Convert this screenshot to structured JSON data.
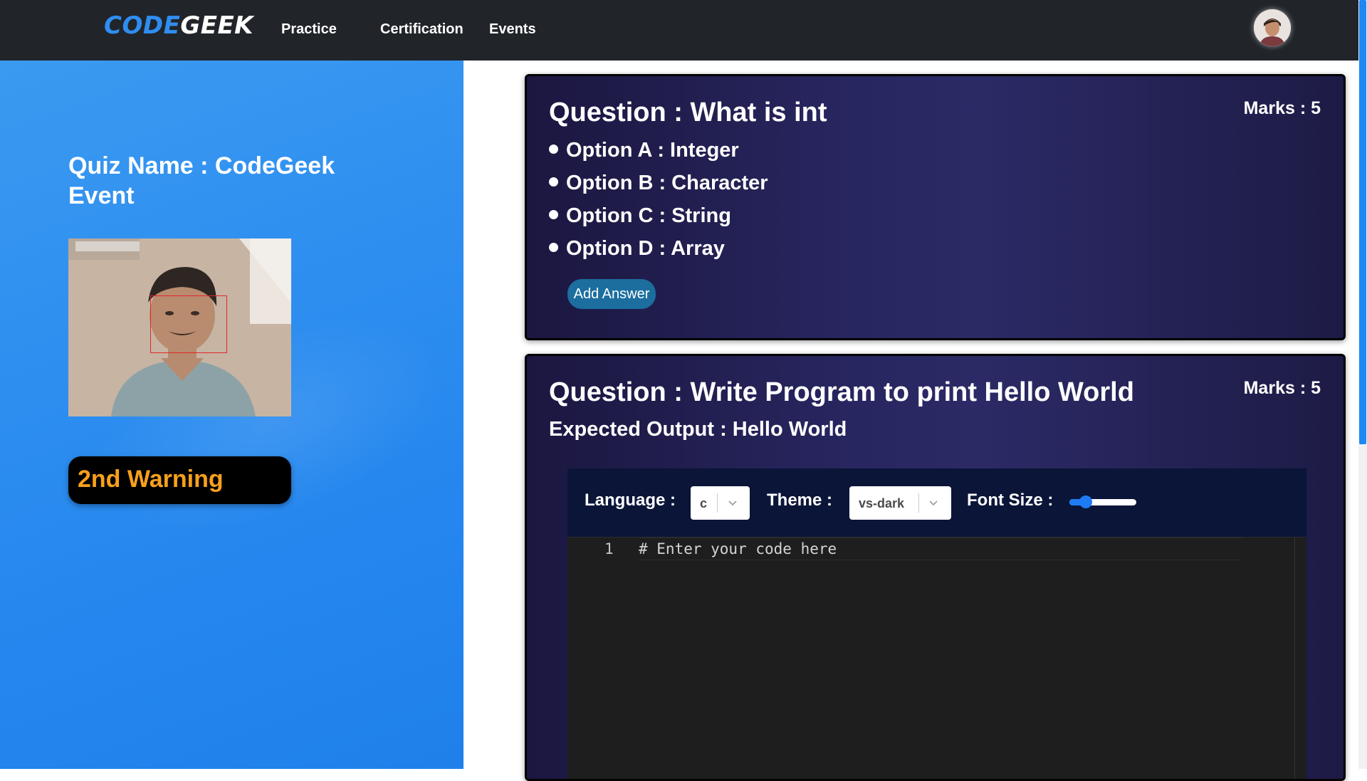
{
  "navbar": {
    "brand_part1": "CODE",
    "brand_part2": "GEEK",
    "links": [
      "Practice",
      "Certification",
      "Events"
    ],
    "avatar_icon": "user-avatar-icon"
  },
  "sidebar": {
    "quiz_name": "Quiz Name : CodeGeek Event",
    "warning": "2nd Warning",
    "warning_color": "#f7a01b"
  },
  "questions": [
    {
      "title": "Question : What is int",
      "marks": "Marks : 5",
      "options": [
        "Option A : Integer",
        "Option B : Character",
        "Option C : String",
        "Option D : Array"
      ],
      "button": "Add Answer"
    },
    {
      "title": "Question : Write Program to print Hello World",
      "marks": "Marks : 5",
      "expected_output": "Expected Output : Hello World",
      "editor": {
        "language_label": "Language :",
        "language_value": "c",
        "theme_label": "Theme :",
        "theme_value": "vs-dark",
        "font_size_label": "Font Size :",
        "font_size_slider_fraction": 0.18,
        "line_number": "1",
        "code": "# Enter your code here"
      }
    }
  ],
  "colors": {
    "navbar_bg": "#212429",
    "brand_accent": "#2f8df0",
    "sidebar_blue": "#2f8ff0",
    "card_bg": "#282660",
    "button_bg": "#1c6e9f",
    "slider_accent": "#1e7cf2"
  }
}
